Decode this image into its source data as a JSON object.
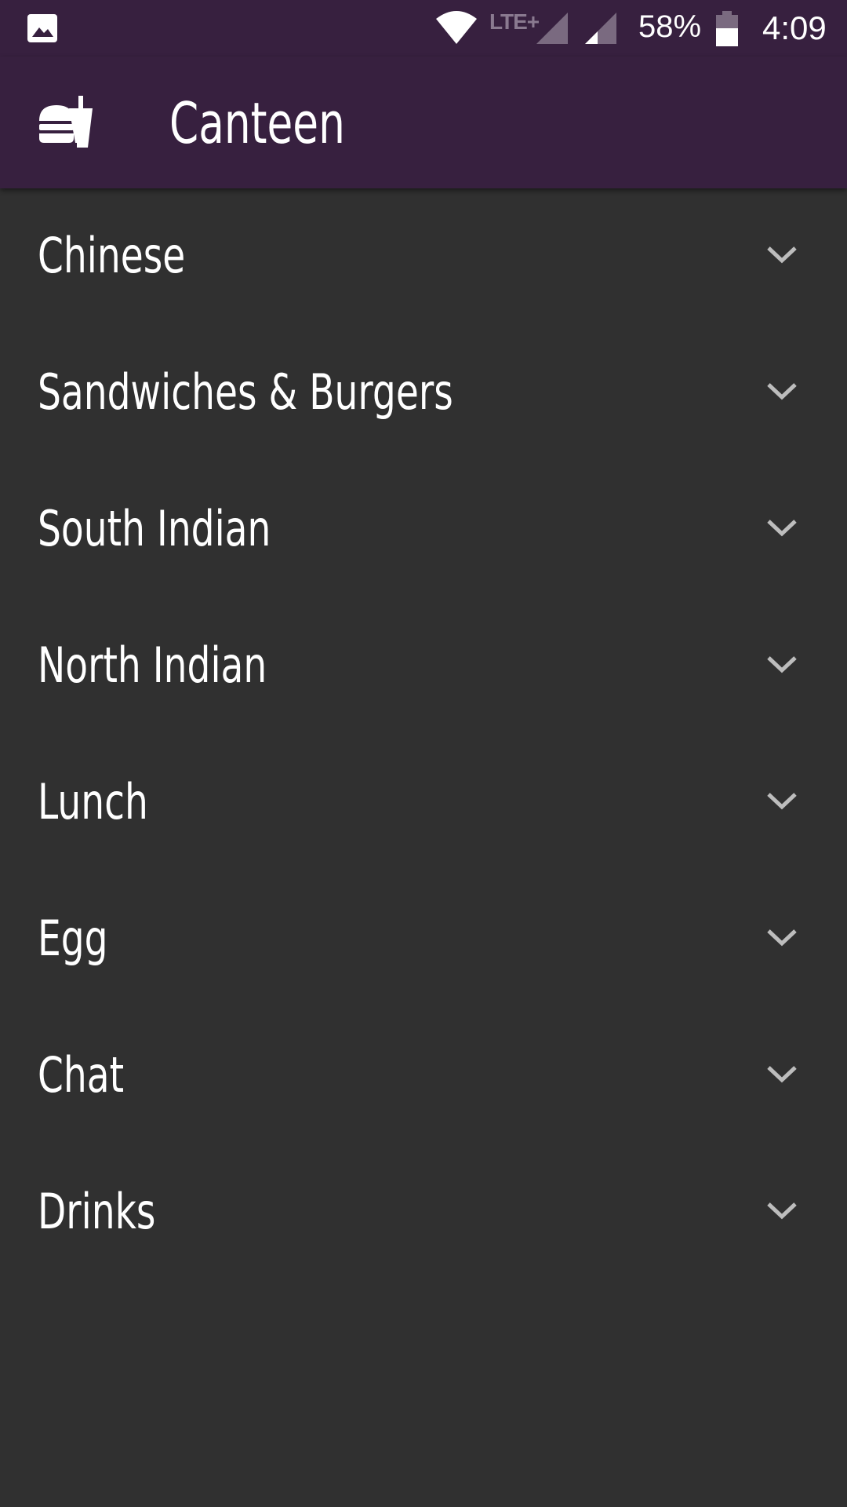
{
  "status_bar": {
    "notification_icon": "gallery-icon",
    "wifi_icon": "wifi-icon",
    "network_type": "LTE+",
    "signal_icons": [
      "cell-signal-icon",
      "cell-signal-icon"
    ],
    "battery_percent": "58%",
    "battery_icon": "battery-icon",
    "time": "4:09"
  },
  "app_bar": {
    "logo_icon": "fastfood-icon",
    "title": "Canteen",
    "background_color": "#37203f"
  },
  "colors": {
    "background": "#303030",
    "chevron": "#bdbdbd"
  },
  "categories": [
    {
      "label": "Chinese",
      "icon": "chevron-down-icon"
    },
    {
      "label": "Sandwiches & Burgers",
      "icon": "chevron-down-icon"
    },
    {
      "label": "South Indian",
      "icon": "chevron-down-icon"
    },
    {
      "label": "North Indian",
      "icon": "chevron-down-icon"
    },
    {
      "label": "Lunch",
      "icon": "chevron-down-icon"
    },
    {
      "label": "Egg",
      "icon": "chevron-down-icon"
    },
    {
      "label": "Chat",
      "icon": "chevron-down-icon"
    },
    {
      "label": "Drinks",
      "icon": "chevron-down-icon"
    }
  ]
}
